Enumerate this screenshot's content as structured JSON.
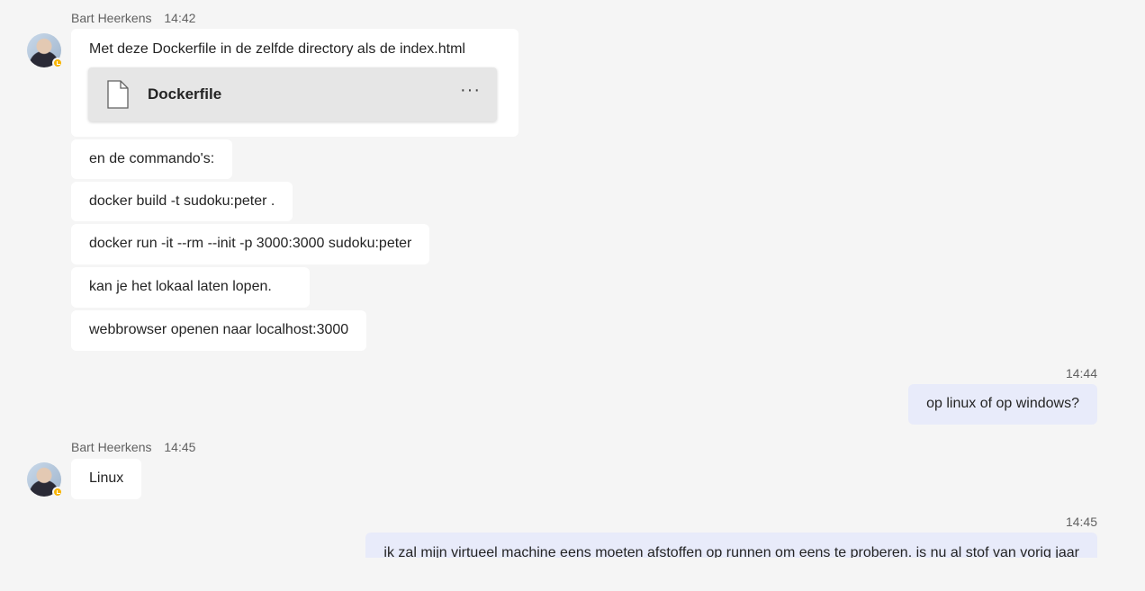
{
  "messages": [
    {
      "sender": "Bart Heerkens",
      "time": "14:42",
      "lines": [
        "Met deze Dockerfile in de zelfde directory als de index.html",
        "en de commando's:",
        "docker build -t sudoku:peter .",
        "docker run -it --rm --init -p 3000:3000 sudoku:peter",
        "kan je het lokaal laten lopen.",
        "webbrowser openen naar localhost:3000"
      ],
      "attachment": {
        "name": "Dockerfile",
        "icon": "file-icon",
        "more_label": "···"
      }
    },
    {
      "time": "14:44",
      "text": "op linux of op windows?"
    },
    {
      "sender": "Bart Heerkens",
      "time": "14:45",
      "text": "Linux"
    },
    {
      "time": "14:45",
      "text": "ik zal mijn virtueel machine eens moeten afstoffen op runnen om eens te proberen. is nu al stof van vorig jaar"
    }
  ],
  "colors": {
    "own_bubble": "#e8ebfa",
    "other_bubble": "#ffffff",
    "status_away": "#f8b400"
  }
}
